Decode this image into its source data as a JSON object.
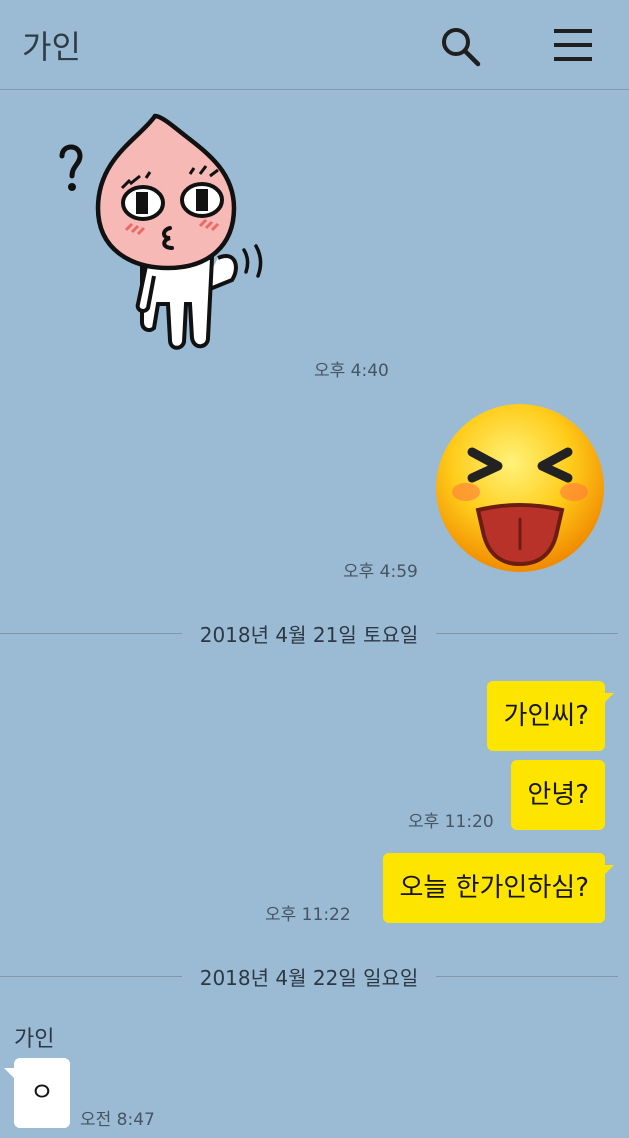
{
  "header": {
    "title": "가인",
    "search_icon": "search-icon",
    "menu_icon": "hamburger-menu-icon"
  },
  "messages": {
    "sticker_peach": {
      "icon": "thinking-peach-sticker",
      "time": "오후 4:40"
    },
    "sticker_emoji": {
      "icon": "tongue-out-emoji-sticker",
      "time": "오후 4:59"
    },
    "date1": "2018년 4월 21일 토요일",
    "out1": "가인씨?",
    "out2": "안녕?",
    "out2_time": "오후 11:20",
    "out3": "오늘 한가인하심?",
    "out3_time": "오후 11:22",
    "date2": "2018년 4월 22일 일요일",
    "in_sender": "가인",
    "in1": "ㅇ",
    "in1_time": "오전 8:47"
  },
  "colors": {
    "background": "#9bbbd4",
    "outgoing_bubble": "#fee500",
    "incoming_bubble": "#ffffff"
  }
}
